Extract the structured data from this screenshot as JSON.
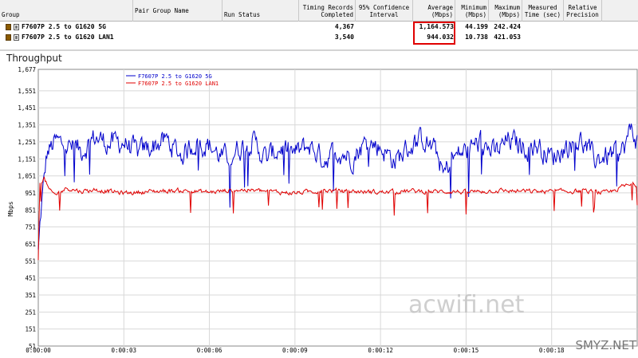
{
  "table": {
    "columns": [
      "Group",
      "Pair Group Name",
      "Run Status",
      "Timing Records Completed",
      "95% Confidence Interval",
      "Average (Mbps)",
      "Minimum (Mbps)",
      "Maximum (Mbps)",
      "Measured Time (sec)",
      "Relative Precision"
    ],
    "rows": [
      {
        "name": "F7607P 2.5 to G1620 5G",
        "records": "4,367",
        "average": "1,164.573",
        "minimum": "44.199",
        "maximum": "242.424"
      },
      {
        "name": "F7607P 2.5 to G1620 LAN1",
        "records": "3,540",
        "average": "944.032",
        "minimum": "10.738",
        "maximum": "421.053"
      }
    ]
  },
  "chart_title": "Throughput",
  "watermarks": {
    "center": "acwifi.net",
    "corner": "SMYZ.NET"
  },
  "chart_data": {
    "type": "line",
    "title": "Throughput",
    "ylabel": "Mbps",
    "xlabel": "",
    "ylim": [
      51,
      1677
    ],
    "yticks": [
      "1,677",
      "1,551",
      "1,451",
      "1,351",
      "1,251",
      "1,151",
      "1,051",
      "951",
      "851",
      "751",
      "651",
      "551",
      "451",
      "351",
      "251",
      "151",
      "51"
    ],
    "xticks": [
      "0:00:00",
      "0:00:03",
      "0:00:06",
      "0:00:09",
      "0:00:12",
      "0:00:15",
      "0:00:18"
    ],
    "grid": true,
    "legend_placement": "top-left",
    "series": [
      {
        "name": "F7607P 2.5 to G1620 5G",
        "color": "#0000cc",
        "anchors_sec": [
          0,
          0.1,
          0.3,
          0.6,
          1,
          1.5,
          2,
          2.5,
          3,
          3.5,
          4,
          4.5,
          5,
          5.5,
          6,
          6.5,
          7,
          7.5,
          8,
          8.5,
          9,
          9.5,
          10,
          10.5,
          11,
          11.5,
          12,
          12.5,
          13,
          13.5,
          14,
          14.2,
          14.5,
          15,
          15.5,
          16,
          16.5,
          17,
          17.5,
          18,
          18.5,
          19,
          19.5,
          20,
          20.5,
          20.8,
          21
        ],
        "anchors_mbps": [
          600,
          850,
          1180,
          1250,
          1230,
          1200,
          1280,
          1240,
          1250,
          1180,
          1230,
          1260,
          1170,
          1250,
          1230,
          1150,
          1210,
          1260,
          1150,
          1220,
          1180,
          1230,
          1150,
          1200,
          1160,
          1250,
          1220,
          1140,
          1220,
          1270,
          1180,
          1050,
          1150,
          1200,
          1250,
          1180,
          1260,
          1220,
          1230,
          1160,
          1220,
          1260,
          1150,
          1170,
          1200,
          1330,
          1250
        ]
      },
      {
        "name": "F7607P 2.5 to G1620 LAN1",
        "color": "#e00000",
        "anchors_sec": [
          0,
          0.05,
          0.2,
          0.4,
          0.6,
          1,
          1.5,
          2,
          3,
          4,
          5,
          6,
          7,
          8,
          9,
          10,
          11,
          12,
          13,
          14,
          14.5,
          15,
          16,
          17,
          18,
          19,
          20,
          20.5,
          21
        ],
        "anchors_mbps": [
          560,
          1000,
          1040,
          960,
          940,
          980,
          960,
          970,
          950,
          960,
          965,
          955,
          970,
          960,
          950,
          965,
          960,
          955,
          962,
          958,
          960,
          955,
          965,
          960,
          958,
          962,
          950,
          990,
          1000
        ]
      }
    ]
  }
}
